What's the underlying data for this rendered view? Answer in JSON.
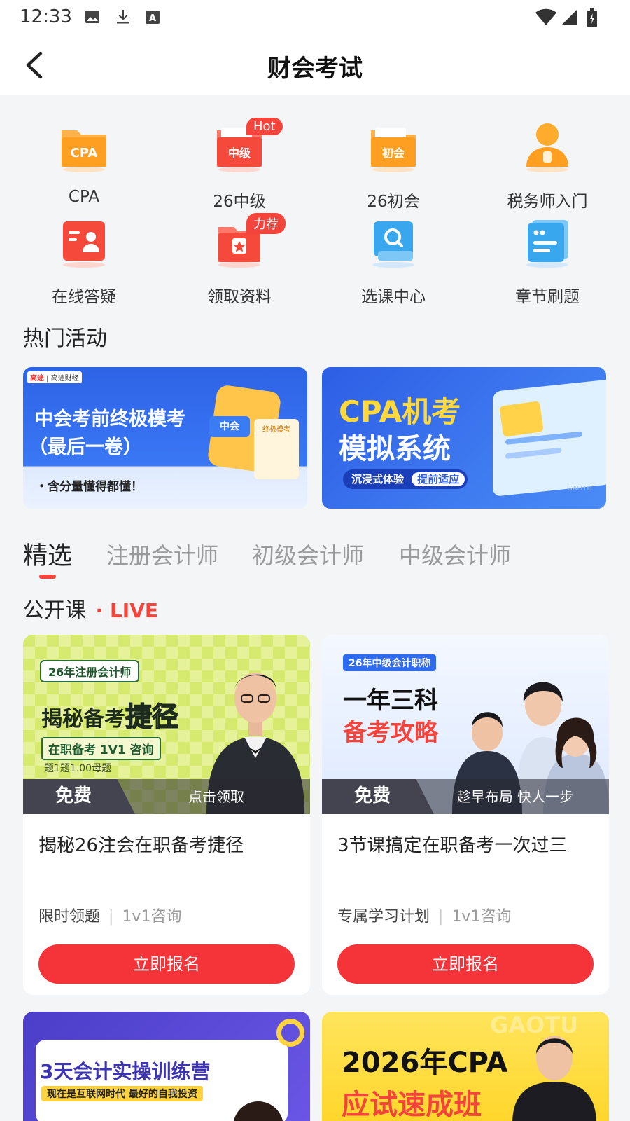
{
  "status_bar": {
    "time": "12:33"
  },
  "header": {
    "title": "财会考试"
  },
  "grid": [
    {
      "label": "CPA",
      "icon": "folder-cpa-icon",
      "glyph": "CPA",
      "badge": ""
    },
    {
      "label": "26中级",
      "icon": "folder-intermediate-icon",
      "glyph": "中级",
      "badge": "Hot"
    },
    {
      "label": "26初会",
      "icon": "folder-junior-icon",
      "glyph": "初会",
      "badge": ""
    },
    {
      "label": "税务师入门",
      "icon": "person-lock-icon",
      "glyph": "",
      "badge": ""
    },
    {
      "label": "在线答疑",
      "icon": "id-card-icon",
      "glyph": "",
      "badge": ""
    },
    {
      "label": "领取资料",
      "icon": "gift-star-icon",
      "glyph": "",
      "badge": "力荐"
    },
    {
      "label": "选课中心",
      "icon": "search-box-icon",
      "glyph": "",
      "badge": ""
    },
    {
      "label": "章节刷题",
      "icon": "quote-note-icon",
      "glyph": "",
      "badge": ""
    }
  ],
  "hot_section": {
    "title": "热门活动"
  },
  "banners": [
    {
      "brand1": "高途",
      "brand2": "高途财经",
      "line1": "中会考前终极模考",
      "line2": "（最后一卷）",
      "bottom": "・含分量懂得都懂！",
      "tag1": "中会",
      "tag2": "终极模考"
    },
    {
      "line1": "CPA机考",
      "line2": "模拟系统",
      "pill1": "沉浸式体验",
      "pill2": "提前适应",
      "watermark": "GAOTU"
    }
  ],
  "tabs": [
    {
      "label": "精选",
      "active": true
    },
    {
      "label": "注册会计师",
      "active": false
    },
    {
      "label": "初级会计师",
      "active": false
    },
    {
      "label": "中级会计师",
      "active": false
    }
  ],
  "open_class": {
    "title": "公开课",
    "live": "LIVE"
  },
  "cards": [
    {
      "thumb_tag": "26年注册会计师",
      "thumb_line1": "揭秘备考",
      "thumb_line1b": "捷径",
      "thumb_line2": "在职备考 1V1 咨询",
      "thumb_line3": "题1题1.00母题",
      "free": "免费",
      "free_note": "点击领取",
      "title": "揭秘26注会在职备考捷径",
      "meta1": "限时领题",
      "meta2": "1v1咨询",
      "cta": "立即报名"
    },
    {
      "thumb_tag": "26年中级会计职称",
      "thumb_line1": "一年三科",
      "thumb_line2": "备考攻略",
      "free": "免费",
      "free_note": "趁早布局 快人一步",
      "title": "3节课搞定在职备考一次过三",
      "meta1": "专属学习计划",
      "meta2": "1v1咨询",
      "cta": "立即报名"
    }
  ],
  "bottom_cards": [
    {
      "line1": "3天会计实操训练营",
      "line2": "现在是互联网时代 最好的自我投资"
    },
    {
      "line1": "2026年CPA",
      "line2": "应试速成班",
      "watermark": "GAOTU"
    }
  ],
  "colors": {
    "accent": "#f5443b",
    "cta": "#f5343a",
    "banner_blue": "#2e63e6"
  }
}
